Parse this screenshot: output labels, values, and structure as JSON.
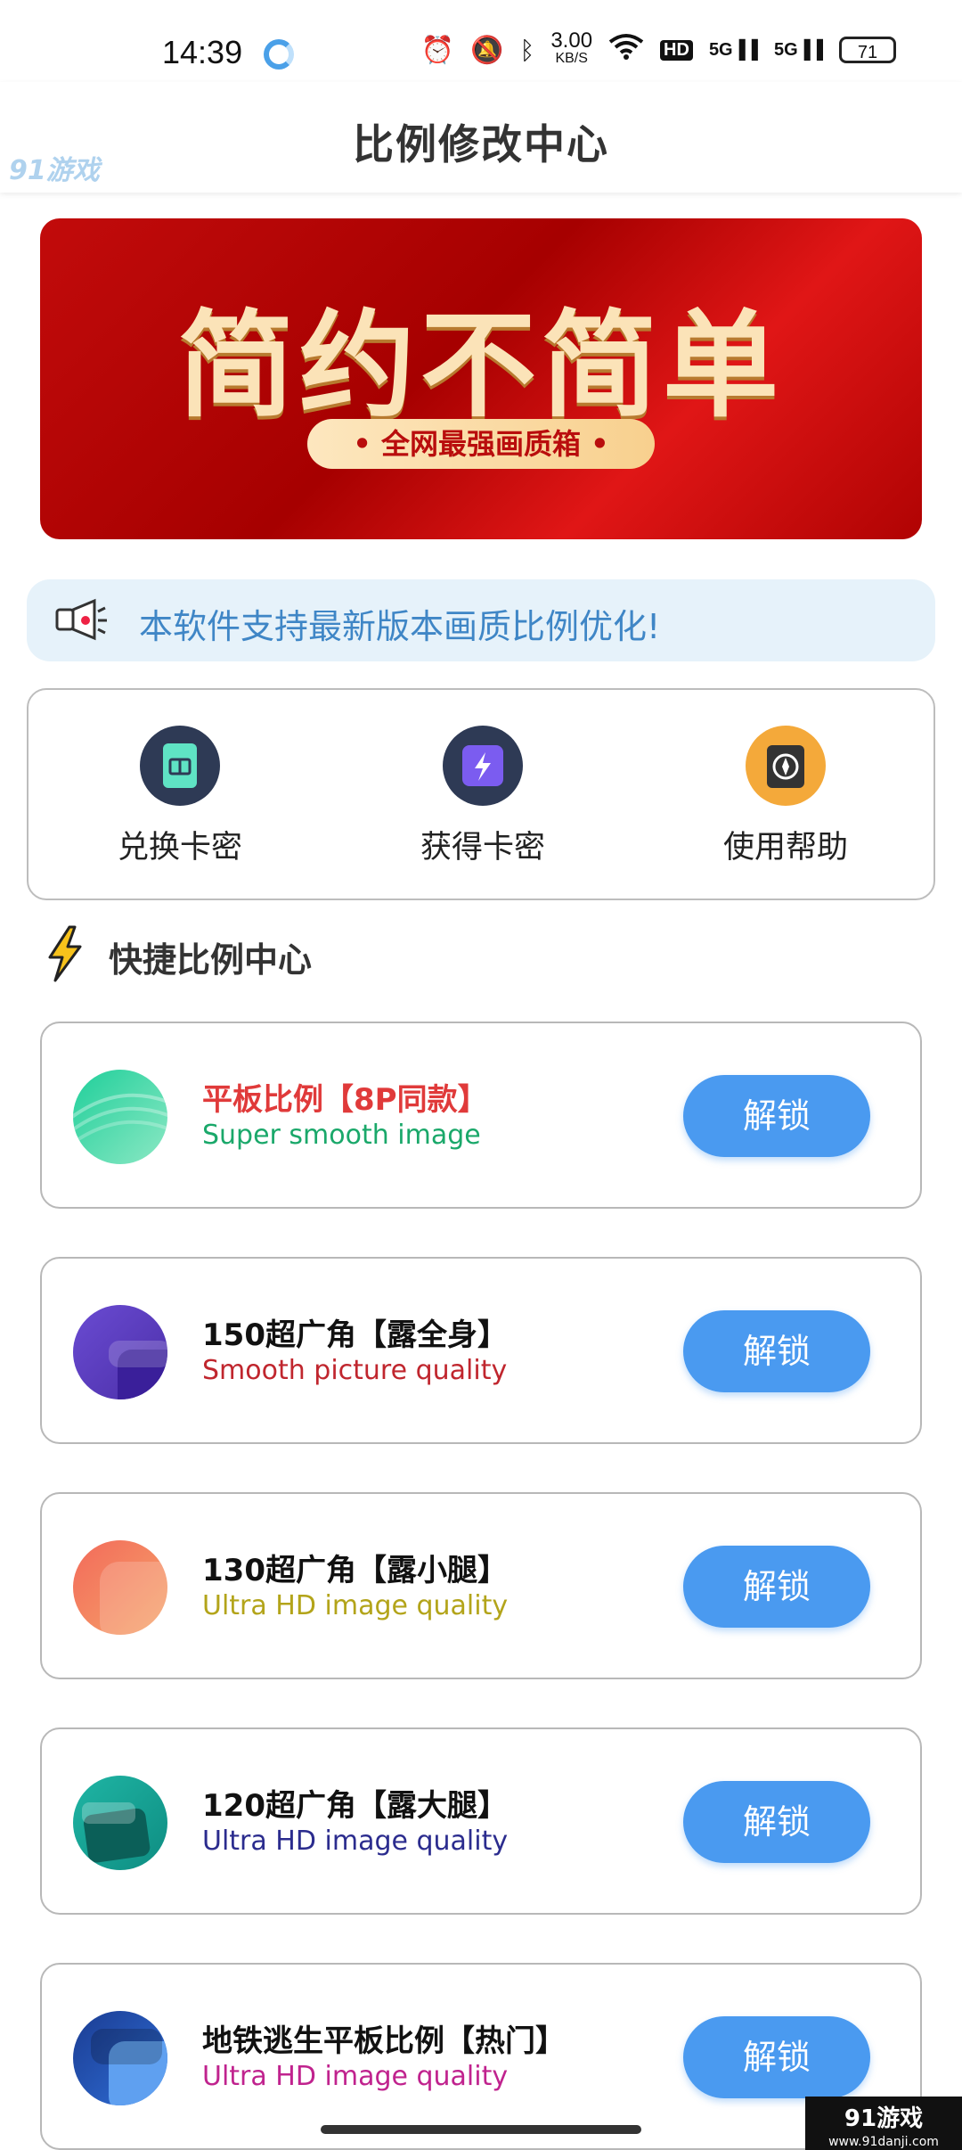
{
  "status_bar": {
    "time": "14:39",
    "net_speed_value": "3.00",
    "net_speed_unit": "KB/S",
    "hd_label": "HD",
    "signal1": "5G",
    "signal2": "5G",
    "battery": "71"
  },
  "header": {
    "title": "比例修改中心",
    "watermark": "91游戏"
  },
  "banner": {
    "title": "简约不简单",
    "pill": "• 全网最强画质箱 •"
  },
  "notice": {
    "text": "本软件支持最新版本画质比例优化!"
  },
  "quick_actions": [
    {
      "label": "兑换卡密",
      "icon": "card-book-icon"
    },
    {
      "label": "获得卡密",
      "icon": "lightning-card-icon"
    },
    {
      "label": "使用帮助",
      "icon": "compass-icon"
    }
  ],
  "section": {
    "title": "快捷比例中心",
    "icon": "lightning-bolt-icon"
  },
  "cards": [
    {
      "title": "平板比例【8P同款】",
      "subtitle": "Super smooth image",
      "button": "解锁",
      "title_color": "#e03a3a",
      "subtitle_color": "#1aa86a"
    },
    {
      "title": "150超广角【露全身】",
      "subtitle": "Smooth picture quality",
      "button": "解锁",
      "title_color": "#111111",
      "subtitle_color": "#c0262e"
    },
    {
      "title": "130超广角【露小腿】",
      "subtitle": "Ultra HD image quality",
      "button": "解锁",
      "title_color": "#111111",
      "subtitle_color": "#b3a41a"
    },
    {
      "title": "120超广角【露大腿】",
      "subtitle": "Ultra HD image quality",
      "button": "解锁",
      "title_color": "#111111",
      "subtitle_color": "#2b2c8e"
    },
    {
      "title": "地铁逃生平板比例【热门】",
      "subtitle": "Ultra HD image quality",
      "button": "解锁",
      "title_color": "#111111",
      "subtitle_color": "#c0238e"
    }
  ],
  "corner_watermark": {
    "main": "91游戏",
    "sub": "www.91danji.com"
  },
  "colors": {
    "accent_button": "#4a9af0",
    "banner_red": "#b00303",
    "notice_bg": "#e6f2fa",
    "notice_text": "#3f86c6"
  }
}
